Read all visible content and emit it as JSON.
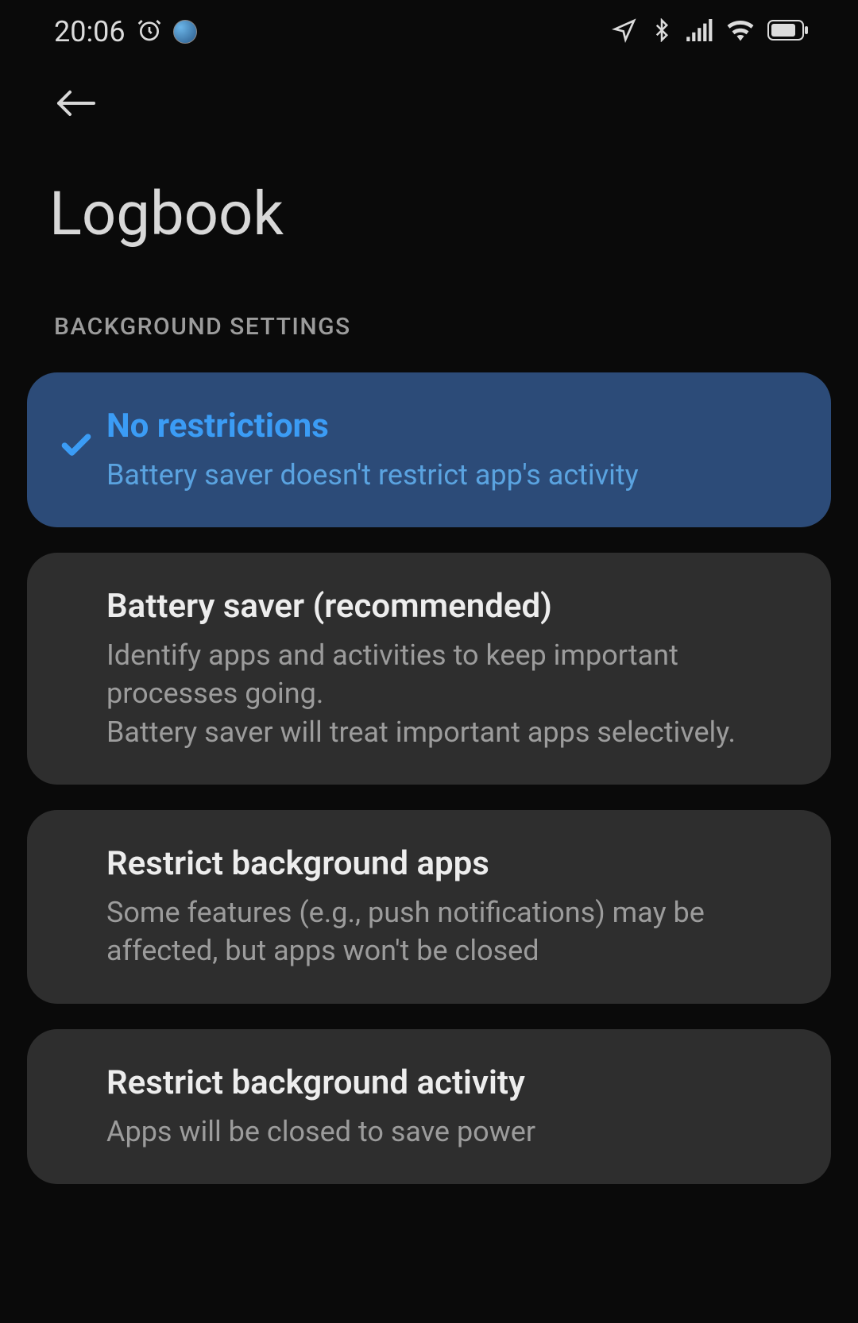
{
  "status": {
    "time": "20:06"
  },
  "page": {
    "title": "Logbook"
  },
  "section": {
    "header": "BACKGROUND SETTINGS"
  },
  "options": [
    {
      "title": "No restrictions",
      "desc": "Battery saver doesn't restrict app's activity",
      "selected": true
    },
    {
      "title": "Battery saver (recommended)",
      "desc": "Identify apps and activities to keep important processes going.\nBattery saver will treat important apps selectively.",
      "selected": false
    },
    {
      "title": "Restrict background apps",
      "desc": "Some features (e.g., push notifications) may be affected, but apps won't be closed",
      "selected": false
    },
    {
      "title": "Restrict background activity",
      "desc": "Apps will be closed to save power",
      "selected": false
    }
  ]
}
